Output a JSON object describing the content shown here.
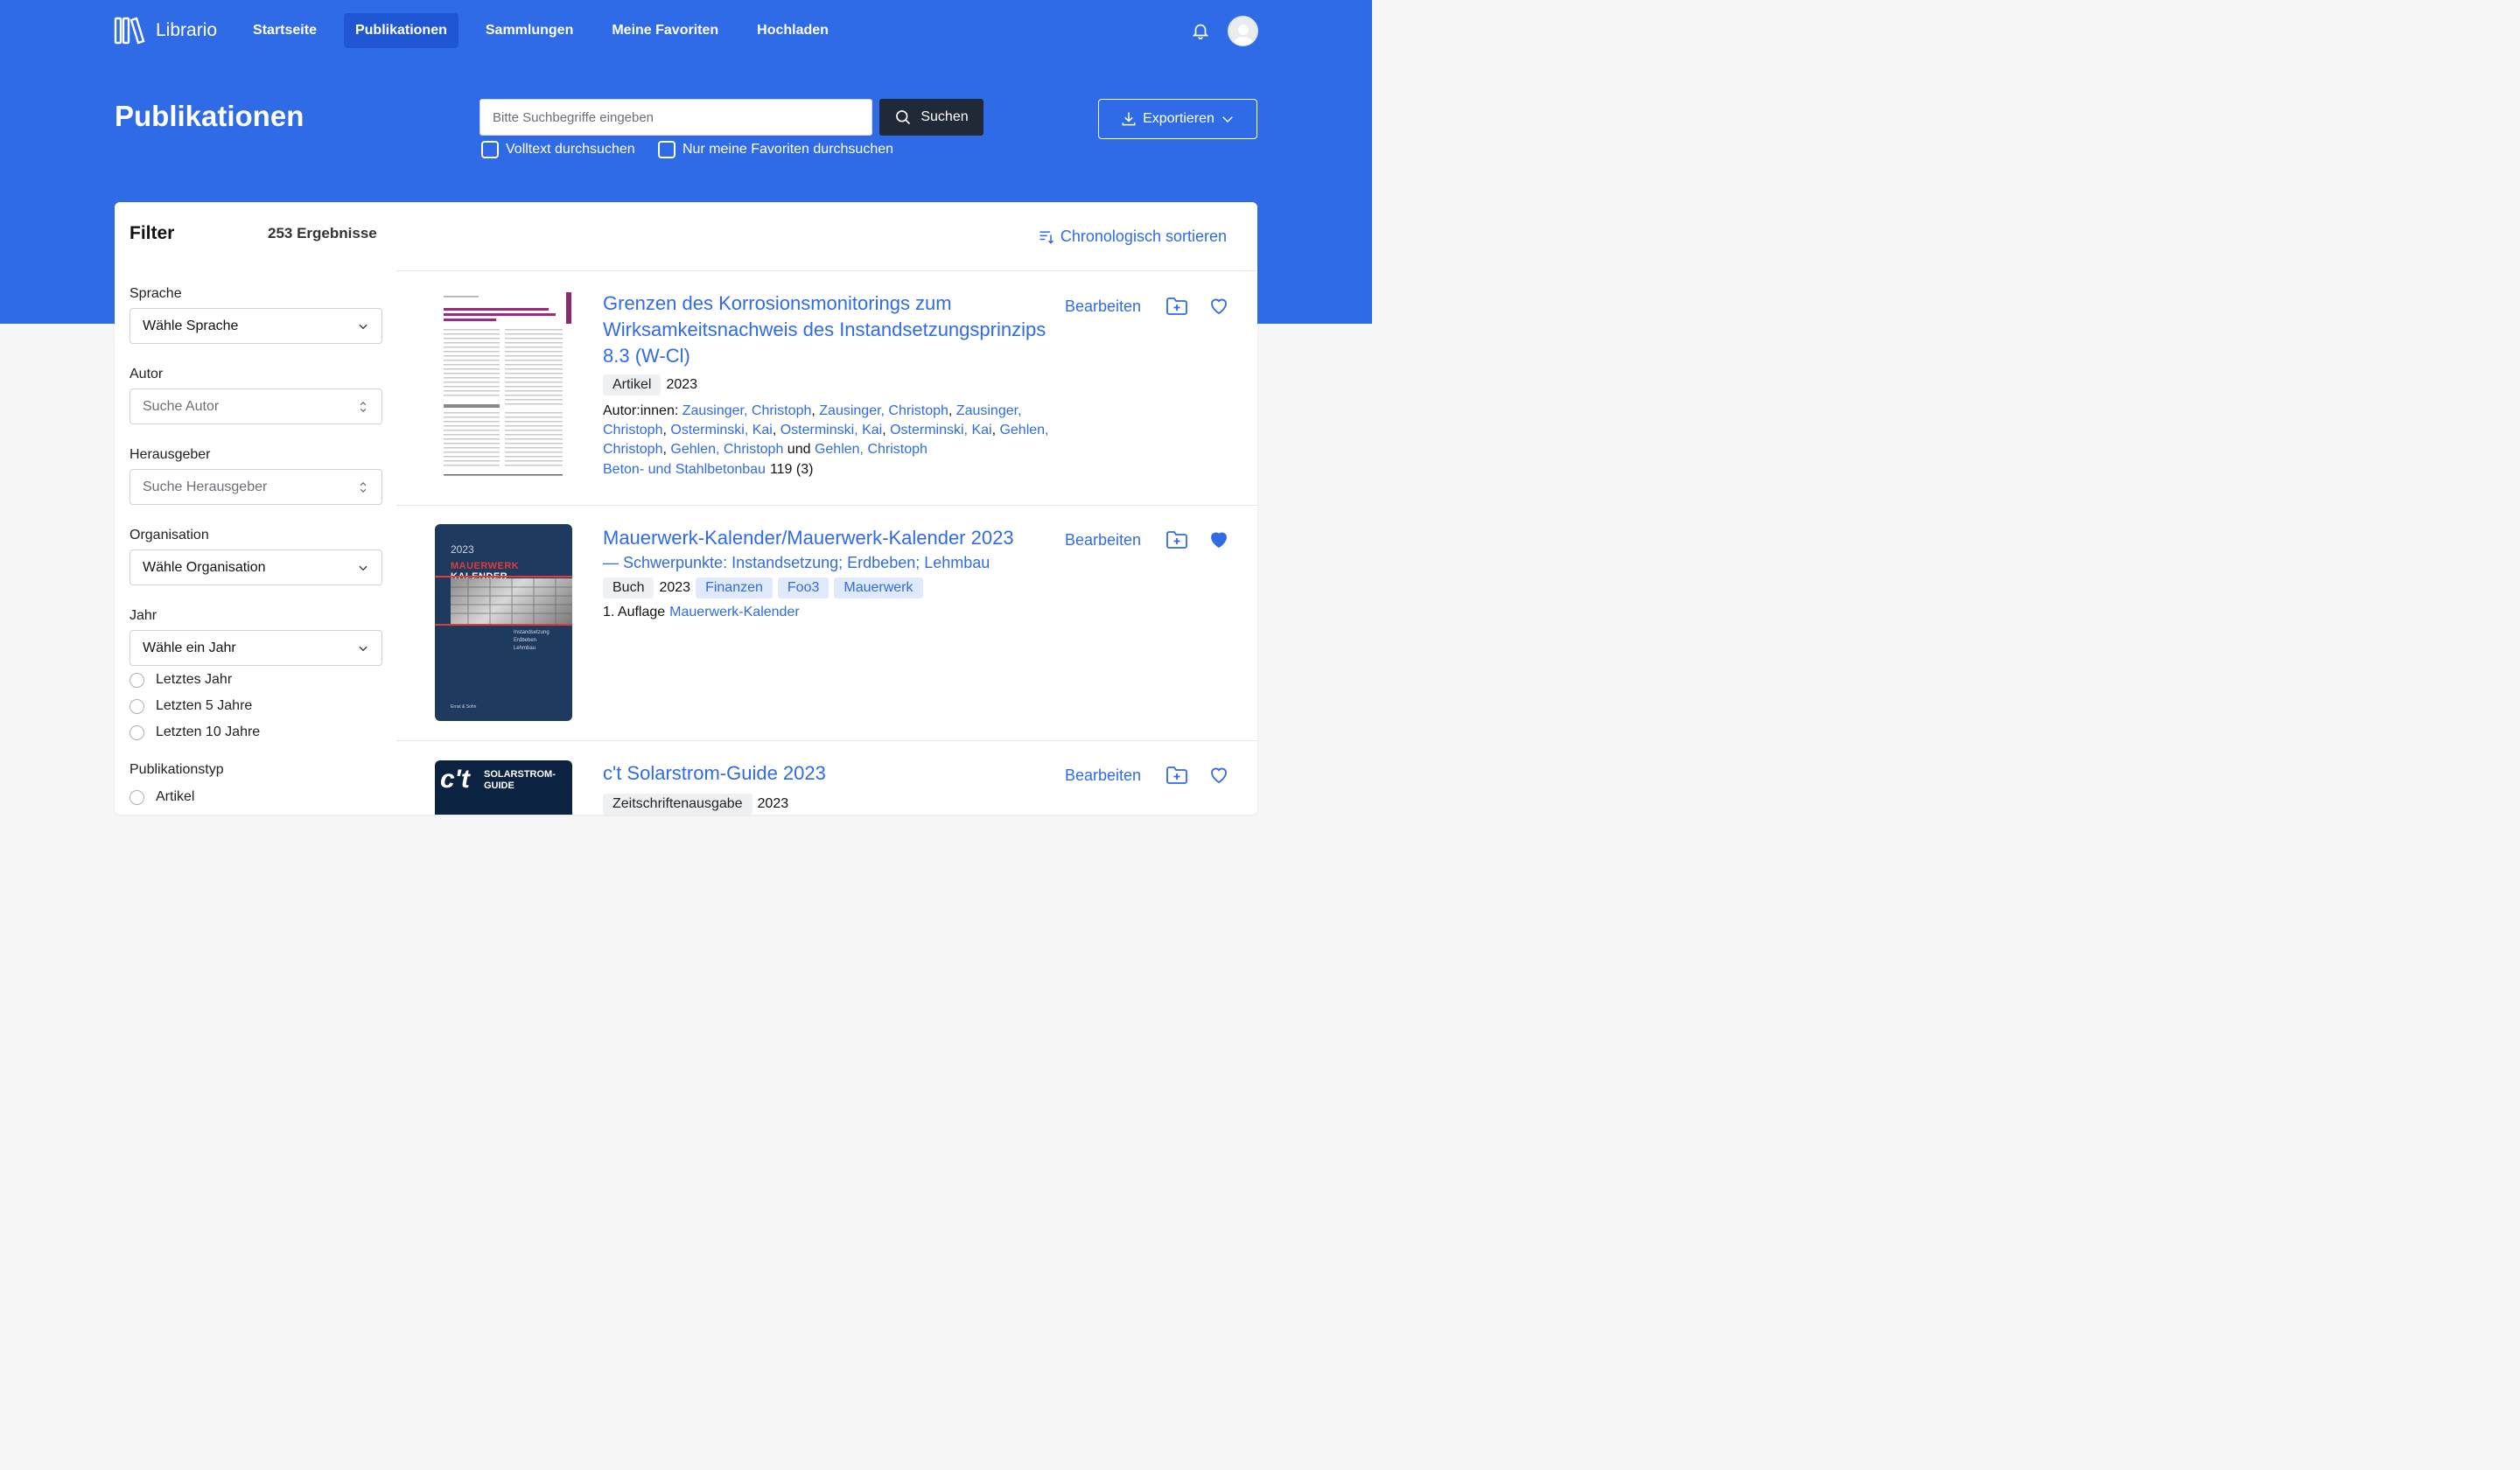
{
  "app": {
    "name": "Librario",
    "colors": {
      "brand": "#2f6be6",
      "dark": "#1f2937"
    }
  },
  "nav": {
    "items": [
      {
        "label": "Startseite"
      },
      {
        "label": "Publikationen",
        "active": true
      },
      {
        "label": "Sammlungen"
      },
      {
        "label": "Meine Favoriten"
      },
      {
        "label": "Hochladen"
      }
    ],
    "icons": [
      "bell-icon",
      "avatar"
    ]
  },
  "header": {
    "title": "Publikationen",
    "search_placeholder": "Bitte Suchbegriffe eingeben",
    "search_button": "Suchen",
    "check_fulltext": "Volltext durchsuchen",
    "check_favorites": "Nur meine Favoriten durchsuchen",
    "export": "Exportieren"
  },
  "filter": {
    "title": "Filter",
    "results": "253 Ergebnisse",
    "language": {
      "label": "Sprache",
      "value": "Wähle Sprache"
    },
    "author": {
      "label": "Autor",
      "placeholder": "Suche Autor"
    },
    "publisher": {
      "label": "Herausgeber",
      "placeholder": "Suche Herausgeber"
    },
    "organisation": {
      "label": "Organisation",
      "value": "Wähle Organisation"
    },
    "year": {
      "label": "Jahr",
      "value": "Wähle ein Jahr",
      "options": [
        "Letztes Jahr",
        "Letzten 5 Jahre",
        "Letzten 10 Jahre"
      ]
    },
    "pubtype": {
      "label": "Publikationstyp",
      "options": [
        "Artikel"
      ]
    }
  },
  "sort": "Chronologisch sortieren",
  "results": [
    {
      "title": "Grenzen des Korrosionsmonitorings zum Wirksamkeitsnachweis des Instandsetzungsprinzips 8.3 (W-Cl)",
      "type": "Artikel",
      "year": "2023",
      "edit": "Bearbeiten",
      "authors_label": "Autor:innen:",
      "authors": [
        "Zausinger, Christoph",
        "Zausinger, Christoph",
        "Zausinger, Christoph",
        "Osterminski, Kai",
        "Osterminski, Kai",
        "Osterminski, Kai",
        "Gehlen, Christoph",
        "Gehlen, Christoph"
      ],
      "authors_last": "Gehlen, Christoph",
      "and": "und",
      "journal": "Beton- und Stahlbetonbau",
      "issue": "119 (3)",
      "favorite": false
    },
    {
      "title": "Mauerwerk-Kalender/Mauerwerk-Kalender 2023",
      "subtitle": "— Schwerpunkte: Instandsetzung; Erdbeben; Lehmbau",
      "type": "Buch",
      "year": "2023",
      "tags": [
        "Finanzen",
        "Foo3",
        "Mauerwerk"
      ],
      "edition": "1. Auflage",
      "series": "Mauerwerk-Kalender",
      "edit": "Bearbeiten",
      "favorite": true,
      "cover": {
        "year": "2023",
        "title_a": "MAUERWERK",
        "title_b": " KALENDER",
        "lines": [
          "Instandsetzung",
          "Erdbeben",
          "Lehmbau"
        ],
        "publisher": "Ernst & Sohn"
      }
    },
    {
      "title": "c't Solarstrom-Guide 2023",
      "type": "Zeitschriftenausgabe",
      "year": "2023",
      "edit": "Bearbeiten",
      "favorite": false,
      "cover": {
        "brand": "c't",
        "line1": "SOLARSTROM-",
        "line2": "GUIDE"
      }
    }
  ]
}
